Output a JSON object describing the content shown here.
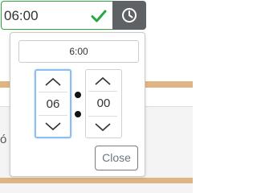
{
  "time_input": {
    "value": "06:00",
    "status": "valid",
    "valid_color": "#28a745"
  },
  "clock_button": {
    "icon": "clock-icon",
    "bg_color": "#5f6265"
  },
  "background": {
    "strip_color": "#dfb584",
    "left_glyph": "ó"
  },
  "picker": {
    "preview": "6:00",
    "hours": {
      "value": "06",
      "focused": true,
      "up_icon": "chevron-up-icon",
      "down_icon": "chevron-down-icon"
    },
    "minutes": {
      "value": "00",
      "focused": false,
      "up_icon": "chevron-up-icon",
      "down_icon": "chevron-down-icon"
    },
    "separator": ":",
    "close_label": "Close"
  }
}
